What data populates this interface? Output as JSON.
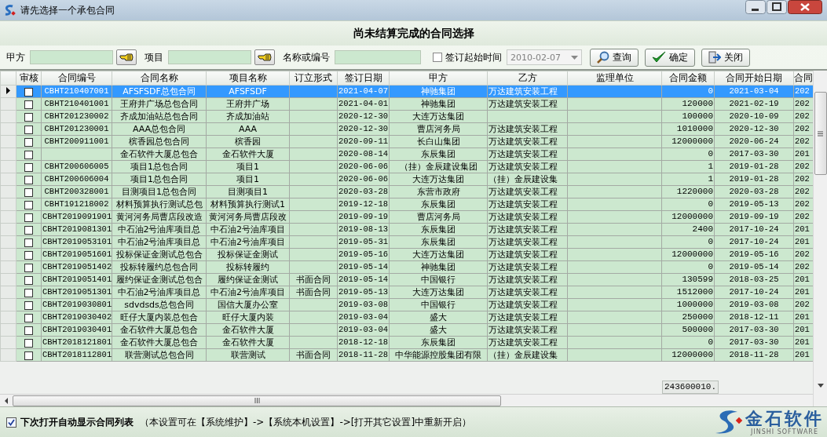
{
  "window": {
    "title": "请先选择一个承包合同"
  },
  "heading": "尚未结算完成的合同选择",
  "filters": [
    {
      "kind": "lookup",
      "label": "甲方"
    },
    {
      "kind": "lookup",
      "label": "项目"
    },
    {
      "kind": "text",
      "label": "名称或编号"
    },
    {
      "kind": "date",
      "label": "签订起始时间",
      "checked": false,
      "value": "2010-02-07"
    }
  ],
  "buttons": [
    {
      "kind": "search",
      "label": "查询"
    },
    {
      "kind": "confirm",
      "label": "确定"
    },
    {
      "kind": "close",
      "label": "关闭"
    }
  ],
  "table": {
    "columns": [
      {
        "kind": "check",
        "label": "审核"
      },
      {
        "kind": "code",
        "label": "合同编号"
      },
      {
        "kind": "text",
        "label": "合同名称"
      },
      {
        "kind": "text",
        "label": "项目名称"
      },
      {
        "kind": "text",
        "label": "订立形式"
      },
      {
        "kind": "code",
        "label": "签订日期"
      },
      {
        "kind": "text",
        "label": "甲方"
      },
      {
        "kind": "left",
        "label": "乙方"
      },
      {
        "kind": "text",
        "label": "监理单位"
      },
      {
        "kind": "amount",
        "label": "合同金额"
      },
      {
        "kind": "code",
        "label": "合同开始日期"
      },
      {
        "kind": "cut",
        "label": "合同"
      }
    ],
    "rows": [
      {
        "selected": true,
        "checked": false,
        "cells": [
          "",
          "CBHT210407001",
          "AFSFSDF总包合同",
          "AFSFSDF",
          "",
          "2021-04-07",
          "神驰集团",
          "万达建筑安装工程",
          "",
          "0",
          "2021-03-04",
          "202"
        ]
      },
      {
        "selected": false,
        "checked": false,
        "cells": [
          "",
          "CBHT210401001",
          "王府井广场总包合同",
          "王府井广场",
          "",
          "2021-04-01",
          "神驰集团",
          "万达建筑安装工程",
          "",
          "120000",
          "2021-02-19",
          "202"
        ]
      },
      {
        "selected": false,
        "checked": false,
        "cells": [
          "",
          "CBHT201230002",
          "齐成加油站总包合同",
          "齐成加油站",
          "",
          "2020-12-30",
          "大连万达集团",
          "",
          "",
          "100000",
          "2020-10-09",
          "202"
        ]
      },
      {
        "selected": false,
        "checked": false,
        "cells": [
          "",
          "CBHT201230001",
          "AAA总包合同",
          "AAA",
          "",
          "2020-12-30",
          "曹店河务局",
          "万达建筑安装工程",
          "",
          "1010000",
          "2020-12-30",
          "202"
        ]
      },
      {
        "selected": false,
        "checked": false,
        "cells": [
          "",
          "CBHT200911001",
          "槟香园总包合同",
          "槟香园",
          "",
          "2020-09-11",
          "长白山集团",
          "万达建筑安装工程",
          "",
          "12000000",
          "2020-06-24",
          "202"
        ]
      },
      {
        "selected": false,
        "checked": false,
        "cells": [
          "",
          "",
          "金石软件大厦总包合",
          "金石软件大厦",
          "",
          "2020-08-14",
          "东辰集团",
          "万达建筑安装工程",
          "",
          "0",
          "2017-03-30",
          "201"
        ]
      },
      {
        "selected": false,
        "checked": false,
        "cells": [
          "",
          "CBHT200606005",
          "项目1总包合同",
          "项目1",
          "",
          "2020-06-06",
          "（挂）金辰建设集团",
          "万达建筑安装工程",
          "",
          "1",
          "2019-01-28",
          "202"
        ]
      },
      {
        "selected": false,
        "checked": false,
        "cells": [
          "",
          "CBHT200606004",
          "项目1总包合同",
          "项目1",
          "",
          "2020-06-06",
          "大连万达集团",
          "（挂）金辰建设集",
          "",
          "1",
          "2019-01-28",
          "202"
        ]
      },
      {
        "selected": false,
        "checked": false,
        "cells": [
          "",
          "CBHT200328001",
          "目测项目1总包合同",
          "目测项目1",
          "",
          "2020-03-28",
          "东营市政府",
          "万达建筑安装工程",
          "",
          "1220000",
          "2020-03-28",
          "202"
        ]
      },
      {
        "selected": false,
        "checked": false,
        "cells": [
          "",
          "CBHT191218002",
          "材料预算执行测试总包",
          "材料预算执行测试1",
          "",
          "2019-12-18",
          "东辰集团",
          "万达建筑安装工程",
          "",
          "0",
          "2019-05-13",
          "202"
        ]
      },
      {
        "selected": false,
        "checked": false,
        "cells": [
          "",
          "CBHT2019091901",
          "黄河河务局曹店段改造",
          "黄河河务局曹店段改",
          "",
          "2019-09-19",
          "曹店河务局",
          "万达建筑安装工程",
          "",
          "12000000",
          "2019-09-19",
          "202"
        ]
      },
      {
        "selected": false,
        "checked": false,
        "cells": [
          "",
          "CBHT2019081301",
          "中石油2号油库项目总",
          "中石油2号油库项目",
          "",
          "2019-08-13",
          "东辰集团",
          "万达建筑安装工程",
          "",
          "2400",
          "2017-10-24",
          "201"
        ]
      },
      {
        "selected": false,
        "checked": false,
        "cells": [
          "",
          "CBHT2019053101",
          "中石油2号油库项目总",
          "中石油2号油库项目",
          "",
          "2019-05-31",
          "东辰集团",
          "万达建筑安装工程",
          "",
          "0",
          "2017-10-24",
          "201"
        ]
      },
      {
        "selected": false,
        "checked": false,
        "cells": [
          "",
          "CBHT2019051601",
          "投标保证金测试总包合",
          "投标保证金测试",
          "",
          "2019-05-16",
          "大连万达集团",
          "万达建筑安装工程",
          "",
          "12000000",
          "2019-05-16",
          "202"
        ]
      },
      {
        "selected": false,
        "checked": false,
        "cells": [
          "",
          "CBHT2019051402",
          "投标转履约总包合同",
          "投标转履约",
          "",
          "2019-05-14",
          "神驰集团",
          "万达建筑安装工程",
          "",
          "0",
          "2019-05-14",
          "202"
        ]
      },
      {
        "selected": false,
        "checked": false,
        "cells": [
          "",
          "CBHT2019051401",
          "履约保证金测试总包合",
          "履约保证金测试",
          "书面合同",
          "2019-05-14",
          "中国银行",
          "万达建筑安装工程",
          "",
          "130599",
          "2018-03-25",
          "201"
        ]
      },
      {
        "selected": false,
        "checked": false,
        "cells": [
          "",
          "CBHT2019051301",
          "中石油2号油库项目总",
          "中石油2号油库项目",
          "书面合同",
          "2019-05-13",
          "大连万达集团",
          "万达建筑安装工程",
          "",
          "1512000",
          "2017-10-24",
          "201"
        ]
      },
      {
        "selected": false,
        "checked": false,
        "cells": [
          "",
          "CBHT2019030801",
          "sdvdsds总包合同",
          "国信大厦办公室",
          "",
          "2019-03-08",
          "中国银行",
          "万达建筑安装工程",
          "",
          "1000000",
          "2019-03-08",
          "202"
        ]
      },
      {
        "selected": false,
        "checked": false,
        "cells": [
          "",
          "CBHT2019030402",
          "旺仔大厦内装总包合",
          "旺仔大厦内装",
          "",
          "2019-03-04",
          "盛大",
          "万达建筑安装工程",
          "",
          "250000",
          "2018-12-11",
          "201"
        ]
      },
      {
        "selected": false,
        "checked": false,
        "cells": [
          "",
          "CBHT2019030401",
          "金石软件大厦总包合",
          "金石软件大厦",
          "",
          "2019-03-04",
          "盛大",
          "万达建筑安装工程",
          "",
          "500000",
          "2017-03-30",
          "201"
        ]
      },
      {
        "selected": false,
        "checked": false,
        "cells": [
          "",
          "CBHT2018121801",
          "金石软件大厦总包合",
          "金石软件大厦",
          "",
          "2018-12-18",
          "东辰集团",
          "万达建筑安装工程",
          "",
          "0",
          "2017-03-30",
          "201"
        ]
      },
      {
        "selected": false,
        "checked": false,
        "cells": [
          "",
          "CBHT2018112801",
          "联营测试总包合同",
          "联营测试",
          "书面合同",
          "2018-11-28",
          "中华能源控股集团有限",
          "（挂）金辰建设集",
          "",
          "12000000",
          "2018-11-28",
          "201"
        ]
      }
    ],
    "total_amount": "243600010."
  },
  "footer": {
    "auto_show": {
      "label": "下次打开自动显示合同列表",
      "checked": true
    },
    "note": "（本设置可在【系统维护】->【系统本机设置】->[打开其它设置]中重新开启）"
  },
  "logo": {
    "name": "金石软件",
    "subtitle": "JINSHI SOFTWARE"
  }
}
